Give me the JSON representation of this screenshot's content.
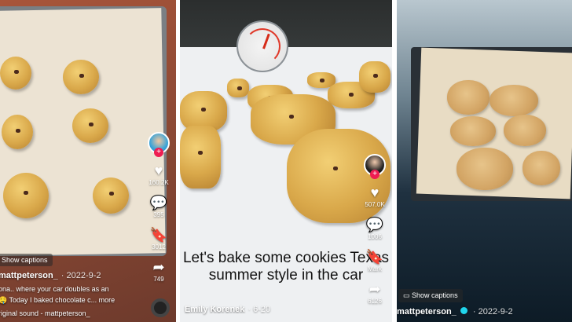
{
  "panel1": {
    "captions_button": "Show captions",
    "username": "mattpeterson_",
    "date": "· 2022-9-2",
    "caption_line1": "ona.. where your car doubles as an",
    "caption_line2": "🤤 Today I baked chocolate c... more",
    "sound": "riginal sound - mattpeterson_",
    "likes": "160.2K",
    "comments": "395",
    "saves": "3012",
    "shares": "749"
  },
  "panel2": {
    "overlay_text": "Let's bake some cookies Texas summer style in the car",
    "username": "Emily Korenek",
    "date": "· 6-20",
    "likes": "507.0K",
    "comments": "1006",
    "saves": "Mark",
    "shares": "6126"
  },
  "panel3": {
    "captions_button": "Show captions",
    "username": "mattpeterson_",
    "date": "· 2022-9-2"
  },
  "icons": {
    "heart": "heart-icon",
    "comment": "comment-icon",
    "bookmark": "bookmark-icon",
    "share": "share-icon",
    "captions": "captions-icon"
  },
  "colors": {
    "tiktok_red": "#ee1d52",
    "parchment": "#efe6d6"
  }
}
